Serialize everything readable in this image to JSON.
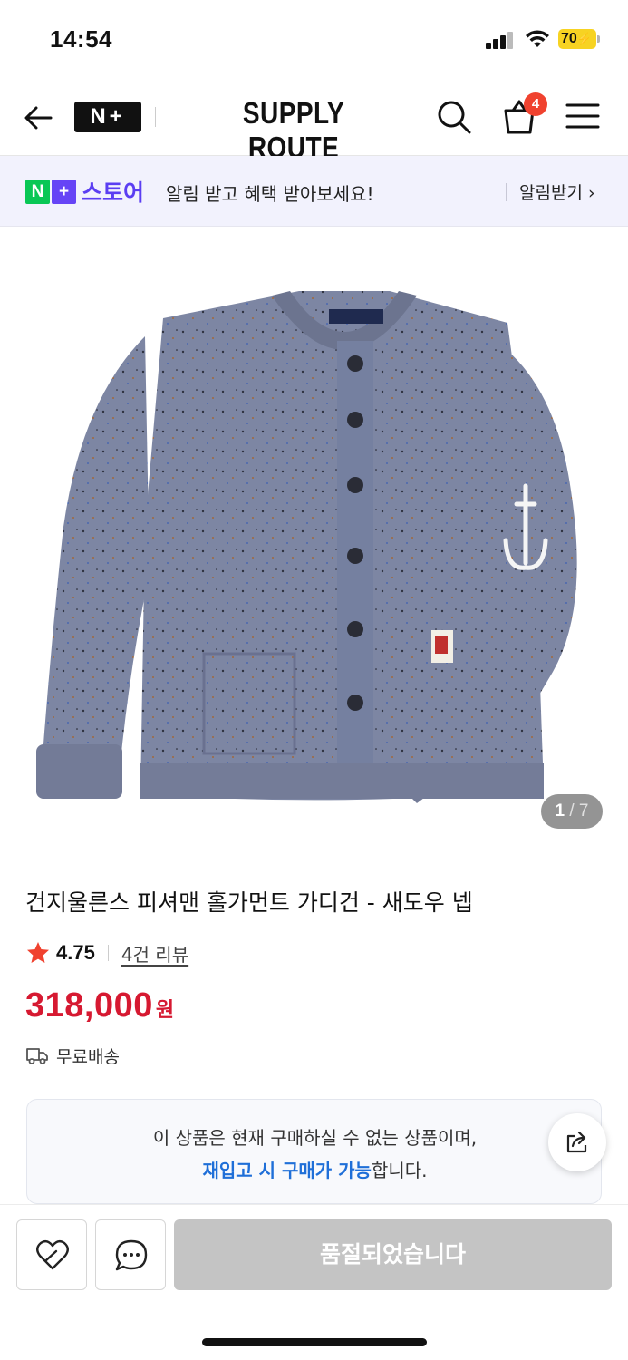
{
  "status_bar": {
    "time": "14:54",
    "battery": "70"
  },
  "header": {
    "np_logo": "N+",
    "brand": "SUPPLY ROUTE",
    "cart_count": "4"
  },
  "alert_banner": {
    "logo_n": "N",
    "logo_plus": "+",
    "logo_store": "스토어",
    "text": "알림 받고 혜택 받아보세요!",
    "link": "알림받기"
  },
  "gallery": {
    "current": "1",
    "separator": "/",
    "total": "7"
  },
  "product": {
    "title": "건지울른스 피셔맨 홀가먼트 가디건 - 새도우 넵",
    "rating": "4.75",
    "review_link": "4건 리뷰",
    "price": "318,000",
    "price_unit": "원",
    "shipping": "무료배송"
  },
  "notice": {
    "line1": "이 상품은 현재 구매하실 수 없는 상품이며,",
    "line2_link": "재입고 시 구매가 가능",
    "line2_suffix": "합니다."
  },
  "bottom_bar": {
    "soldout_label": "품절되었습니다"
  },
  "colors": {
    "price": "#d61931",
    "link_blue": "#1f6fd8",
    "naver_green": "#09c755",
    "naver_purple": "#6644f6",
    "cart_badge": "#f0422f",
    "star": "#f0422f",
    "sweater": "#7d86a3"
  },
  "icons": [
    "back-arrow-icon",
    "search-icon",
    "shopping-bag-icon",
    "hamburger-menu-icon",
    "star-icon",
    "truck-icon",
    "share-icon",
    "heart-icon",
    "chat-bubble-icon",
    "chevron-right-icon"
  ]
}
